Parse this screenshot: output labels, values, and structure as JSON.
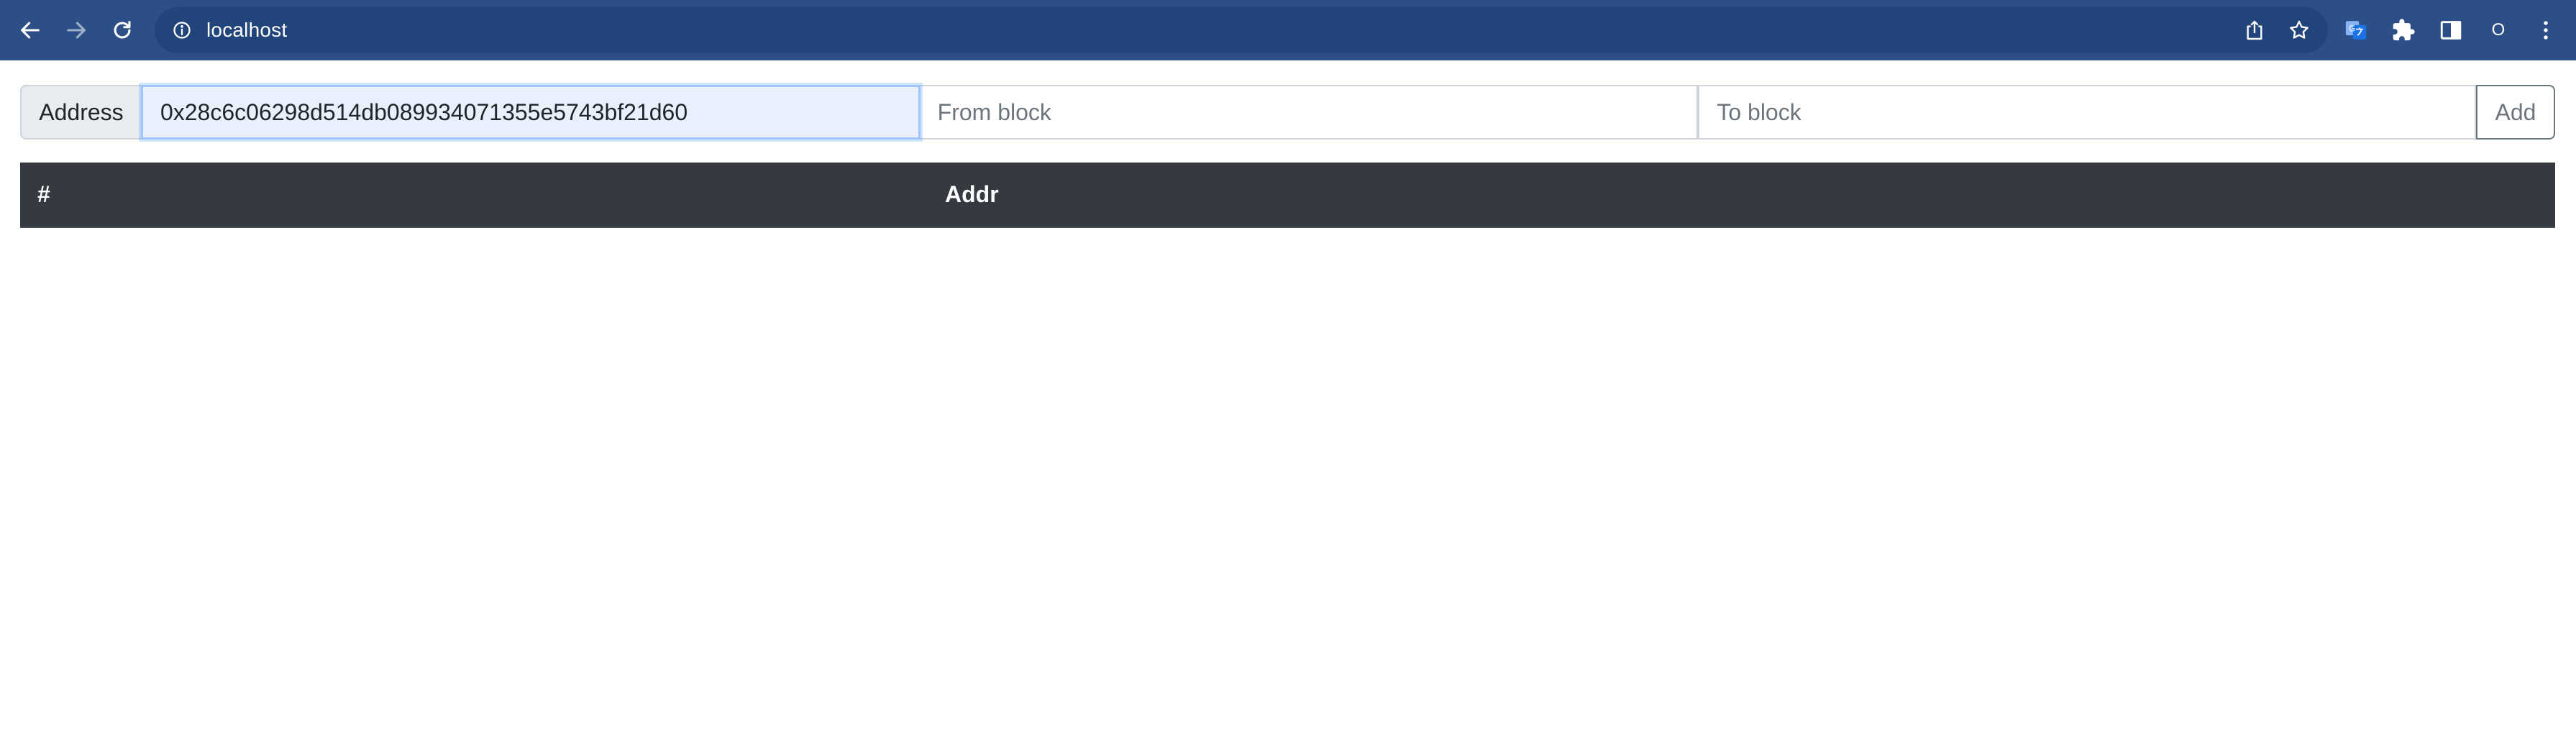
{
  "browser": {
    "url": "localhost",
    "profile_initial": "O",
    "icons": {
      "back": "arrow-left-icon",
      "forward": "arrow-right-icon",
      "reload": "reload-icon",
      "site_info": "info-icon",
      "share": "share-icon",
      "bookmark": "star-icon",
      "translate_extension": "translate-icon",
      "extensions": "puzzle-icon",
      "side_panel": "side-panel-icon",
      "menu": "more-vert-icon"
    },
    "colors": {
      "toolbar": "#2b4f86",
      "omnibox": "#21447a"
    }
  },
  "form": {
    "address_label": "Address",
    "address_value": "0x28c6c06298d514db089934071355e5743bf21d60",
    "from_block_placeholder": "From block",
    "to_block_placeholder": "To block",
    "add_label": "Add"
  },
  "table": {
    "columns": [
      "#",
      "Addr"
    ],
    "rows": [],
    "header_color": "#343a40"
  }
}
